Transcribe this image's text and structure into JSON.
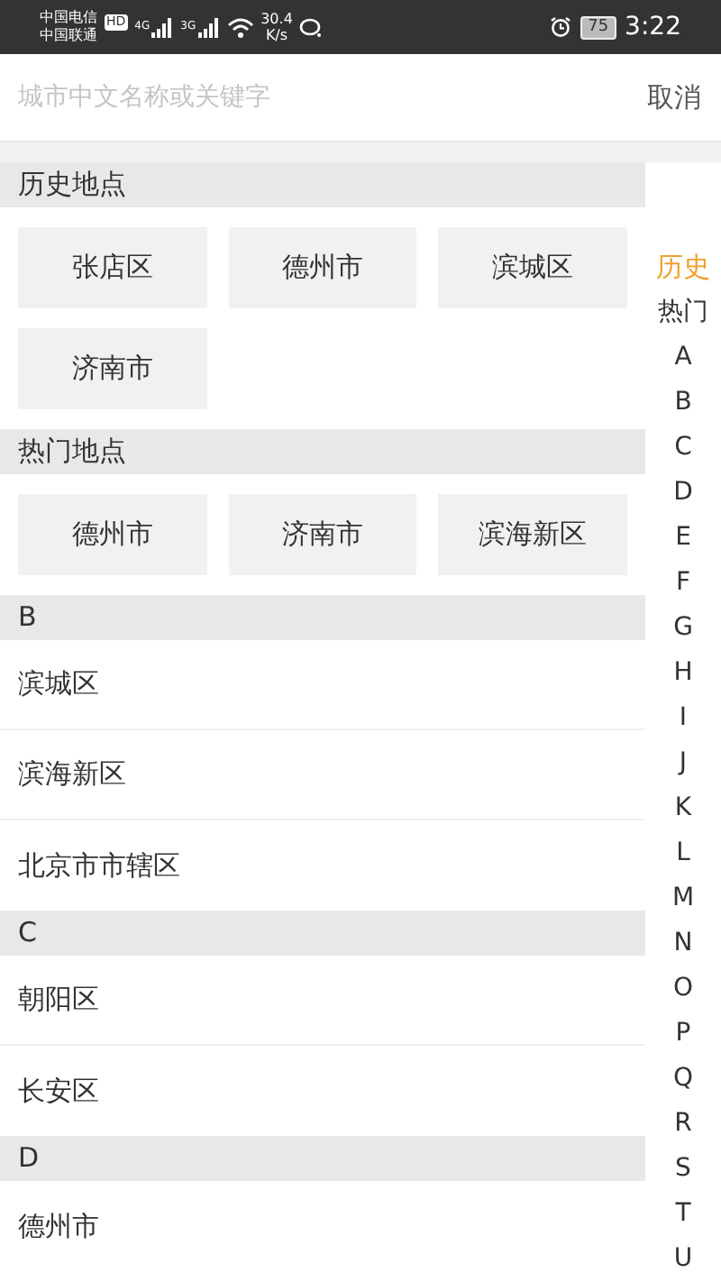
{
  "status_bar": {
    "carriers": [
      "中国电信",
      "中国联通"
    ],
    "hd_badge": "HD",
    "network_1": "4G",
    "network_2": "3G",
    "speed": "30.4",
    "speed_unit": "K/s",
    "battery": "75",
    "time": "3:22"
  },
  "search": {
    "placeholder": "城市中文名称或关键字",
    "cancel": "取消"
  },
  "sections": [
    {
      "title": "历史地点",
      "kind": "chips",
      "items": [
        "张店区",
        "德州市",
        "滨城区",
        "济南市"
      ]
    },
    {
      "title": "热门地点",
      "kind": "chips",
      "items": [
        "德州市",
        "济南市",
        "滨海新区"
      ]
    },
    {
      "title": "B",
      "kind": "list",
      "items": [
        "滨城区",
        "滨海新区",
        "北京市市辖区"
      ]
    },
    {
      "title": "C",
      "kind": "list",
      "items": [
        "朝阳区",
        "长安区"
      ]
    },
    {
      "title": "D",
      "kind": "list",
      "items": [
        "德州市"
      ]
    }
  ],
  "index_bar": [
    {
      "label": "历史",
      "selected": true
    },
    {
      "label": "热门",
      "selected": false
    },
    {
      "label": "A",
      "selected": false
    },
    {
      "label": "B",
      "selected": false
    },
    {
      "label": "C",
      "selected": false
    },
    {
      "label": "D",
      "selected": false
    },
    {
      "label": "E",
      "selected": false
    },
    {
      "label": "F",
      "selected": false
    },
    {
      "label": "G",
      "selected": false
    },
    {
      "label": "H",
      "selected": false
    },
    {
      "label": "I",
      "selected": false
    },
    {
      "label": "J",
      "selected": false
    },
    {
      "label": "K",
      "selected": false
    },
    {
      "label": "L",
      "selected": false
    },
    {
      "label": "M",
      "selected": false
    },
    {
      "label": "N",
      "selected": false
    },
    {
      "label": "O",
      "selected": false
    },
    {
      "label": "P",
      "selected": false
    },
    {
      "label": "Q",
      "selected": false
    },
    {
      "label": "R",
      "selected": false
    },
    {
      "label": "S",
      "selected": false
    },
    {
      "label": "T",
      "selected": false
    },
    {
      "label": "U",
      "selected": false
    }
  ]
}
